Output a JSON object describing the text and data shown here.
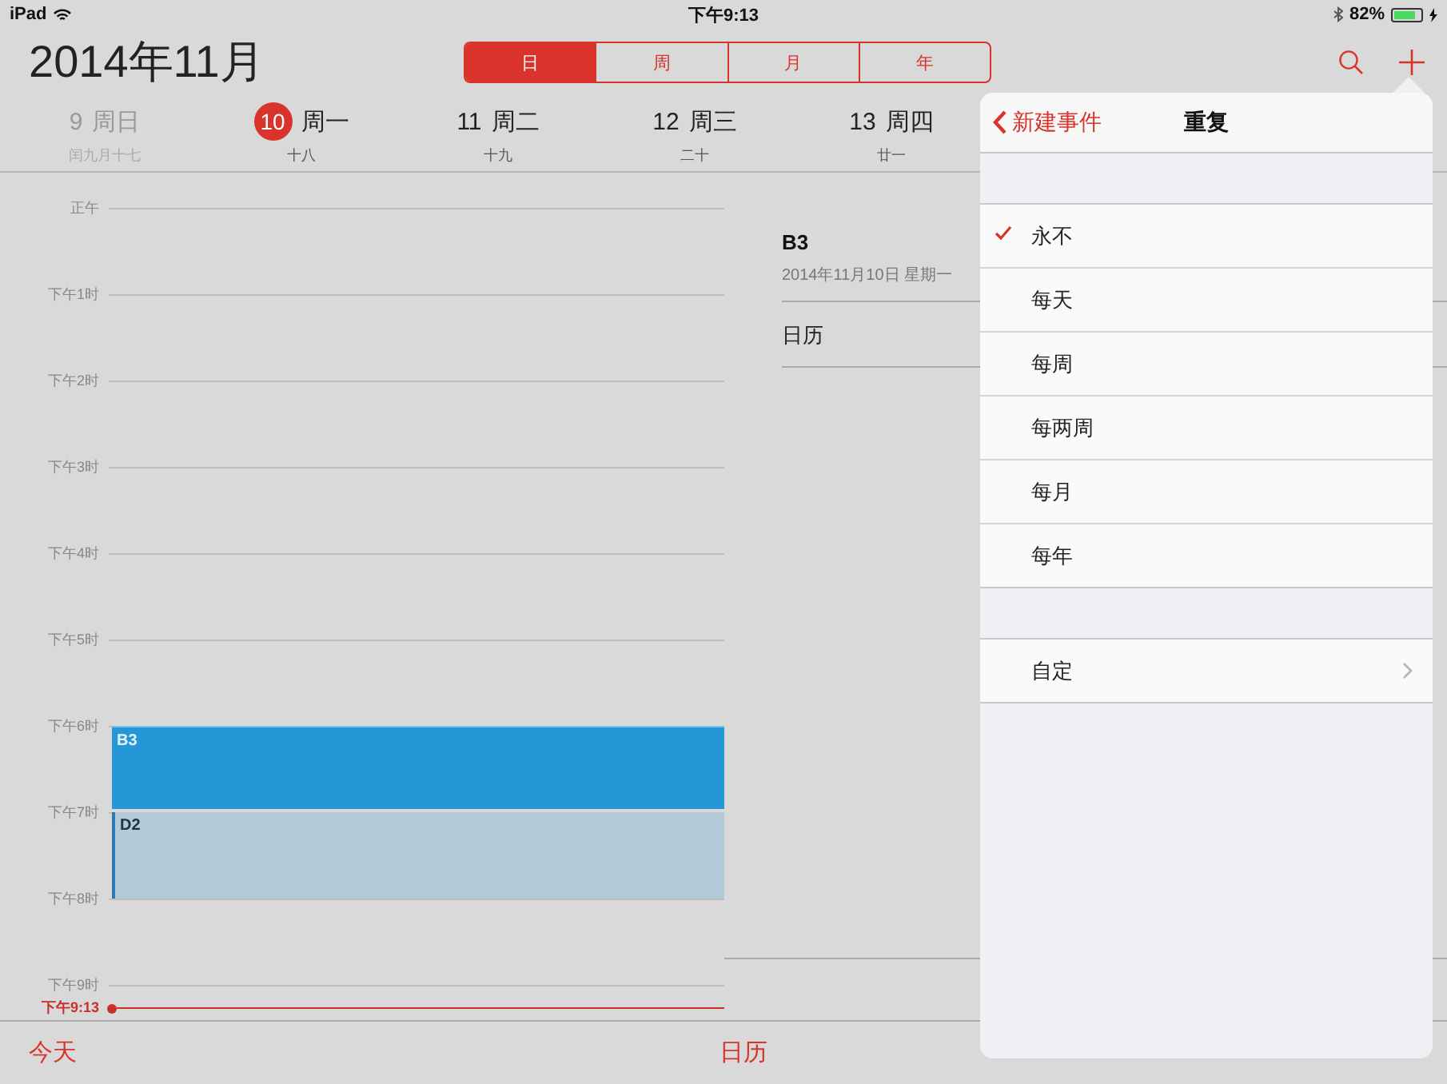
{
  "status_bar": {
    "device": "iPad",
    "time": "下午9:13",
    "battery": "82%"
  },
  "header": {
    "title": "2014年11月",
    "segments": [
      {
        "label": "日",
        "selected": true
      },
      {
        "label": "周",
        "selected": false
      },
      {
        "label": "月",
        "selected": false
      },
      {
        "label": "年",
        "selected": false
      }
    ]
  },
  "days": [
    {
      "date": "9",
      "weekday": "周日",
      "lunar": "闰九月十七",
      "today": false,
      "past": true
    },
    {
      "date": "10",
      "weekday": "周一",
      "lunar": "十八",
      "today": true,
      "past": false
    },
    {
      "date": "11",
      "weekday": "周二",
      "lunar": "十九",
      "today": false,
      "past": false
    },
    {
      "date": "12",
      "weekday": "周三",
      "lunar": "二十",
      "today": false,
      "past": false
    },
    {
      "date": "13",
      "weekday": "周四",
      "lunar": "廿一",
      "today": false,
      "past": false
    }
  ],
  "timeline": {
    "hours": [
      {
        "label": "正午"
      },
      {
        "label": "下午1时"
      },
      {
        "label": "下午2时"
      },
      {
        "label": "下午3时"
      },
      {
        "label": "下午4时"
      },
      {
        "label": "下午5时"
      },
      {
        "label": "下午6时",
        "events": [
          {
            "title": "B3",
            "selected": true
          }
        ]
      },
      {
        "label": "下午7时",
        "events": [
          {
            "title": "D2",
            "selected": false
          }
        ]
      },
      {
        "label": "下午8时"
      },
      {
        "label": "下午9时"
      }
    ],
    "now": "下午9:13"
  },
  "detail": {
    "title": "B3",
    "date": "2014年11月10日 星期一",
    "calendar": "日历"
  },
  "popover": {
    "back": "新建事件",
    "title": "重复",
    "options": [
      {
        "label": "永不",
        "selected": true
      },
      {
        "label": "每天",
        "selected": false
      },
      {
        "label": "每周",
        "selected": false
      },
      {
        "label": "每两周",
        "selected": false
      },
      {
        "label": "每月",
        "selected": false
      },
      {
        "label": "每年",
        "selected": false
      }
    ],
    "custom": "自定"
  },
  "toolbar": {
    "today": "今天",
    "calendars": "日历"
  }
}
